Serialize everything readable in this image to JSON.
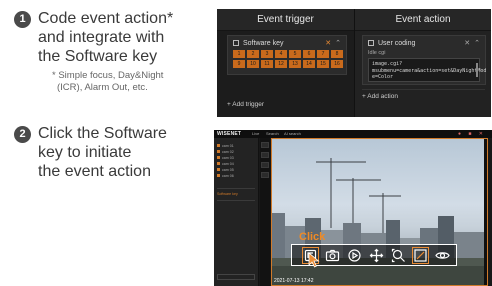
{
  "steps": [
    {
      "number": "1",
      "title_lines": [
        "Code event action*",
        "and integrate with",
        "the Software key"
      ],
      "note_lines": [
        "* Simple focus, Day&Night",
        "(ICR), Alarm Out, etc."
      ]
    },
    {
      "number": "2",
      "title_lines": [
        "Click the Software",
        "key to initiate",
        "the event action"
      ]
    }
  ],
  "event_panel": {
    "trigger_header": "Event trigger",
    "action_header": "Event action",
    "software_key_card": {
      "title": "Software key",
      "keys": [
        "1",
        "2",
        "3",
        "4",
        "5",
        "6",
        "7",
        "8",
        "9",
        "10",
        "11",
        "12",
        "13",
        "14",
        "15",
        "16"
      ]
    },
    "user_coding_card": {
      "title": "User coding",
      "field_label": "Idle cgi",
      "code_lines": [
        "image.cgi?",
        "msubmenu=camera&action=set&DayNightMod",
        "e=Color"
      ]
    },
    "add_trigger_label": "+ Add trigger",
    "add_action_label": "+ Add action"
  },
  "viewer": {
    "brand": "WISENET",
    "menu_items": [
      "Live",
      "Search",
      "AI search"
    ],
    "timestamp": "2021-07-13  17:42",
    "click_label": "Click",
    "toolbar_icons": [
      "software-key-icon",
      "snapshot-icon",
      "playback-icon",
      "ptz-move-icon",
      "digital-zoom-icon",
      "aspect-ratio-icon",
      "visibility-icon"
    ],
    "side_tags": [
      "Software key"
    ]
  },
  "colors": {
    "accent_orange": "#e98b34",
    "key_orange": "#c96a1c",
    "panel_dark": "#1f1f1f"
  }
}
